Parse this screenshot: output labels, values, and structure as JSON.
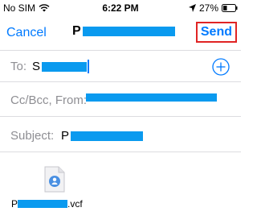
{
  "status_bar": {
    "carrier": "No SIM",
    "time": "6:22 PM",
    "battery": "27%"
  },
  "nav": {
    "cancel_label": "Cancel",
    "title_prefix": "P",
    "send_label": "Send"
  },
  "to_field": {
    "label": "To:",
    "value_prefix": "S"
  },
  "ccbcc_field": {
    "label": "Cc/Bcc, From:"
  },
  "subject_field": {
    "label": "Subject:",
    "value_prefix": "P"
  },
  "attachment": {
    "name_prefix": "P",
    "name_suffix": ".vcf"
  },
  "colors": {
    "accent": "#007aff",
    "highlight_border": "#e02424",
    "redaction": "#0a9aef"
  }
}
